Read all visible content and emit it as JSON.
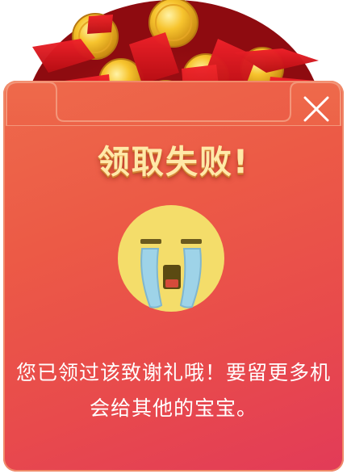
{
  "dialog": {
    "title": "领取失败!",
    "message": "您已领过该致谢礼哦！要留更多机会给其他的宝宝。"
  },
  "icons": {
    "close": "close-icon",
    "emoji": "crying-face-icon",
    "hero": "red-envelopes-and-gold-coins"
  },
  "colors": {
    "card_top": "#ee6a4b",
    "card_bottom": "#e23b58",
    "title_gold": "#ffe9a8",
    "emoji_yellow": "#f4dd6a",
    "tears_blue": "#9ed3e8"
  }
}
